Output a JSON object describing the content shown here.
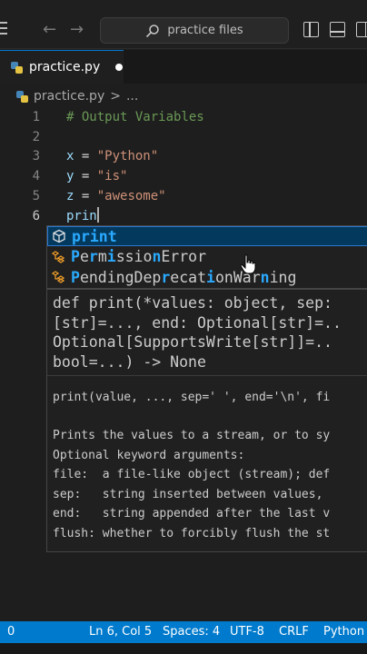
{
  "window": {
    "search_text": "practice files"
  },
  "tab": {
    "label": "practice.py"
  },
  "breadcrumb": {
    "file": "practice.py",
    "separator": ">",
    "more": "..."
  },
  "editor": {
    "lines": [
      {
        "num": "1",
        "parts": [
          {
            "cls": "tok-comment",
            "text": "# Output Variables"
          }
        ]
      },
      {
        "num": "2",
        "parts": []
      },
      {
        "num": "3",
        "parts": [
          {
            "cls": "tok-var",
            "text": "x"
          },
          {
            "cls": "",
            "text": " = "
          },
          {
            "cls": "tok-str",
            "text": "\"Python\""
          }
        ]
      },
      {
        "num": "4",
        "parts": [
          {
            "cls": "tok-var",
            "text": "y"
          },
          {
            "cls": "",
            "text": " = "
          },
          {
            "cls": "tok-str",
            "text": "\"is\""
          }
        ]
      },
      {
        "num": "5",
        "parts": [
          {
            "cls": "tok-var",
            "text": "z"
          },
          {
            "cls": "",
            "text": " = "
          },
          {
            "cls": "tok-str",
            "text": "\"awesome\""
          }
        ]
      },
      {
        "num": "6",
        "parts": [
          {
            "cls": "tok-var",
            "text": "prin"
          }
        ],
        "active": true
      }
    ]
  },
  "suggestions": [
    {
      "icon": "function-cube-icon",
      "segments": [
        {
          "hl": true,
          "text": "print"
        }
      ]
    },
    {
      "icon": "class-icon",
      "segments": [
        {
          "hl": true,
          "text": "P"
        },
        {
          "hl": false,
          "text": "e"
        },
        {
          "hl": true,
          "text": "r"
        },
        {
          "hl": false,
          "text": "m"
        },
        {
          "hl": true,
          "text": "i"
        },
        {
          "hl": false,
          "text": "ssio"
        },
        {
          "hl": true,
          "text": "n"
        },
        {
          "hl": false,
          "text": "Error"
        }
      ]
    },
    {
      "icon": "class-icon",
      "segments": [
        {
          "hl": true,
          "text": "P"
        },
        {
          "hl": false,
          "text": "endingDep"
        },
        {
          "hl": true,
          "text": "r"
        },
        {
          "hl": false,
          "text": "ecat"
        },
        {
          "hl": true,
          "text": "i"
        },
        {
          "hl": false,
          "text": "onWar"
        },
        {
          "hl": true,
          "text": "n"
        },
        {
          "hl": false,
          "text": "ing"
        }
      ]
    }
  ],
  "details": {
    "signature": [
      "def print(*values: object, sep:",
      "[str]=..., end: Optional[str]=..",
      "Optional[SupportsWrite[str]]=..",
      "bool=...) -> None"
    ],
    "usage": "print(value, ..., sep=' ', end='\\n', fi",
    "doc": [
      "Prints the values to a stream, or to sy",
      "Optional keyword arguments:",
      "file:  a file-like object (stream); def",
      "sep:   string inserted between values, ",
      "end:   string appended after the last v",
      "flush: whether to forcibly flush the st"
    ]
  },
  "statusbar": {
    "problems": "0",
    "position": "Ln 6, Col 5",
    "spaces": "Spaces: 4",
    "encoding": "UTF-8",
    "eol": "CRLF",
    "language": "Python"
  },
  "colors": {
    "status_bg": "#007acc",
    "selection_bg": "#04395e",
    "match_highlight": "#2aaaff",
    "comment": "#6a9955",
    "string": "#ce9178"
  }
}
